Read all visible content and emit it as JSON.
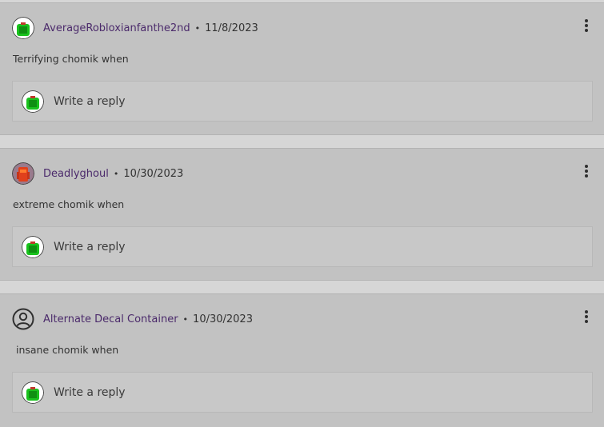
{
  "comments": [
    {
      "username": "AverageRobloxianfanthe2nd",
      "separator": "•",
      "date": "11/8/2023",
      "text": "Terrifying chomik when",
      "avatar_icon": "green-chomik-avatar-icon",
      "reply_placeholder": "Write a reply"
    },
    {
      "username": "Deadlyghoul",
      "separator": "•",
      "date": "10/30/2023",
      "text": "extreme chomik when",
      "avatar_icon": "red-character-avatar-icon",
      "reply_placeholder": "Write a reply"
    },
    {
      "username": "Alternate Decal Container",
      "separator": "•",
      "date": "10/30/2023",
      "text": " insane chomik when",
      "avatar_icon": "default-user-icon",
      "reply_placeholder": "Write a reply"
    }
  ],
  "reply_avatar_icon": "green-chomik-avatar-icon",
  "colors": {
    "username": "#4b2a6b",
    "card_background": "#c2c2c2",
    "page_background": "#d6d6d6"
  }
}
